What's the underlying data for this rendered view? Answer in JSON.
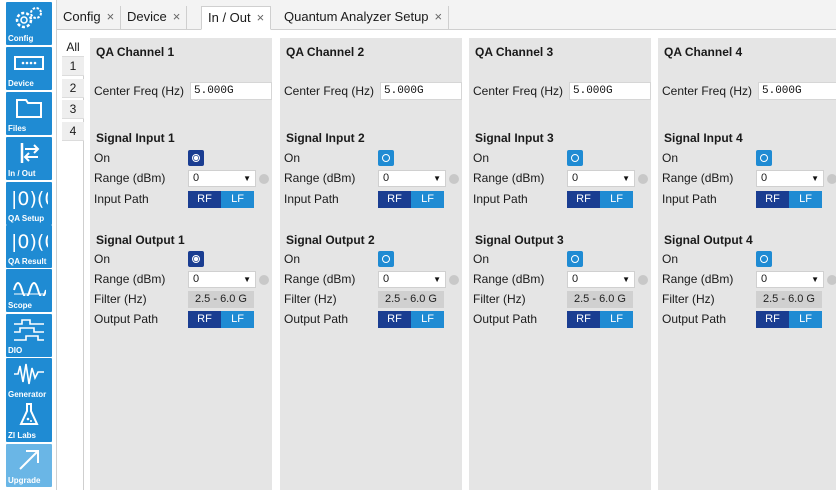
{
  "sidebar": [
    {
      "label": "Config",
      "icon": "gears-icon"
    },
    {
      "label": "Device",
      "icon": "device-icon"
    },
    {
      "label": "Files",
      "icon": "folder-icon"
    },
    {
      "label": "In / Out",
      "icon": "inout-icon"
    },
    {
      "label": "QA Setup",
      "icon": "qa-setup-icon"
    },
    {
      "label": "QA Result",
      "icon": "qa-result-icon"
    },
    {
      "label": "Scope",
      "icon": "scope-icon"
    },
    {
      "label": "DIO",
      "icon": "dio-icon"
    },
    {
      "label": "Generator",
      "icon": "generator-icon"
    },
    {
      "label": "ZI Labs",
      "icon": "flask-icon"
    },
    {
      "label": "Upgrade",
      "icon": "upgrade-icon"
    }
  ],
  "tabs": [
    {
      "label": "Config",
      "close": "×"
    },
    {
      "label": "Device",
      "close": "×"
    },
    {
      "label": "In / Out",
      "close": "×"
    },
    {
      "label": "Quantum Analyzer Setup",
      "close": "×"
    }
  ],
  "subtabs": [
    "All",
    "1",
    "2",
    "3",
    "4"
  ],
  "labels": {
    "center_freq": "Center Freq (Hz)",
    "on": "On",
    "range": "Range (dBm)",
    "input_path": "Input Path",
    "filter": "Filter (Hz)",
    "output_path": "Output Path",
    "rf": "RF",
    "lf": "LF"
  },
  "channels": [
    {
      "title": "QA Channel 1",
      "freq": "5.000G",
      "input_title": "Signal Input 1",
      "input_on": true,
      "input_range": "0",
      "output_title": "Signal Output 1",
      "output_on": true,
      "output_range": "0",
      "filter": "2.5 - 6.0 G"
    },
    {
      "title": "QA Channel 2",
      "freq": "5.000G",
      "input_title": "Signal Input 2",
      "input_on": false,
      "input_range": "0",
      "output_title": "Signal Output 2",
      "output_on": false,
      "output_range": "0",
      "filter": "2.5 - 6.0 G"
    },
    {
      "title": "QA Channel 3",
      "freq": "5.000G",
      "input_title": "Signal Input 3",
      "input_on": false,
      "input_range": "0",
      "output_title": "Signal Output 3",
      "output_on": false,
      "output_range": "0",
      "filter": "2.5 - 6.0 G"
    },
    {
      "title": "QA Channel 4",
      "freq": "5.000G",
      "input_title": "Signal Input 4",
      "input_on": false,
      "input_range": "0",
      "output_title": "Signal Output 4",
      "output_on": false,
      "output_range": "0",
      "filter": "2.5 - 6.0 G"
    }
  ],
  "colors": {
    "accent": "#1f8bd3",
    "active": "#1a3d91",
    "panel": "#e5e5e5"
  }
}
